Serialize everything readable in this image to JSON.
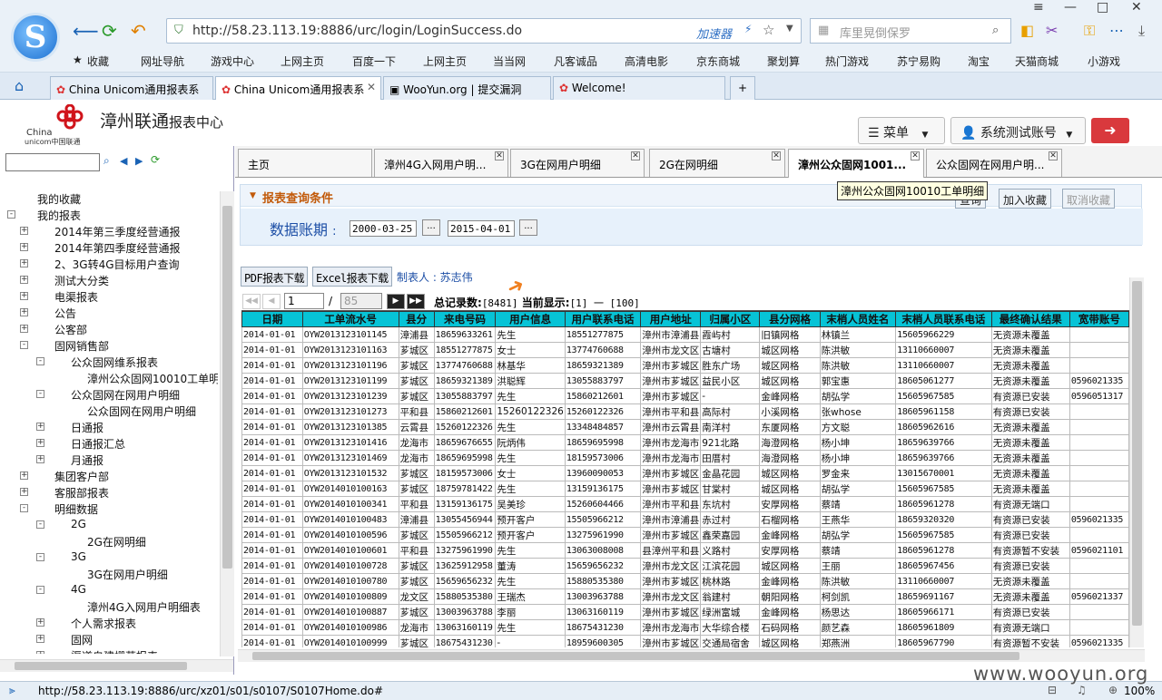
{
  "browser": {
    "url": "http://58.23.113.19:8886/urc/login/LoginSuccess.do",
    "accelerator": "加速器",
    "search_placeholder": "库里晃倒保罗",
    "favorites": [
      "收藏",
      "网址导航",
      "游戏中心",
      "上网主页",
      "百度一下",
      "上网主页",
      "当当网",
      "凡客诚品",
      "高清电影",
      "京东商城",
      "聚划算",
      "热门游戏",
      "苏宁易购",
      "淘宝",
      "天猫商城",
      "小游戏"
    ],
    "tabs": [
      {
        "label": "China Unicom通用报表系",
        "active": false
      },
      {
        "label": "China Unicom通用报表系",
        "active": true
      },
      {
        "label": "WooYun.org | 提交漏洞",
        "active": false
      },
      {
        "label": "Welcome!",
        "active": false
      }
    ],
    "status_url": "http://58.23.113.19:8886/urc/xz01/s01/s0107/S0107Home.do#",
    "zoom": "100%"
  },
  "app": {
    "logo_en_line1": "China",
    "logo_en_line2": "unicom中国联通",
    "title_main": "漳州联通",
    "title_sub": "报表中心",
    "menu_label": "菜单",
    "account_label": "系统测试账号"
  },
  "sidebar": {
    "tree": [
      {
        "label": "我的收藏",
        "level": 0,
        "exp": ""
      },
      {
        "label": "我的报表",
        "level": 0,
        "exp": "-"
      },
      {
        "label": "2014年第三季度经营通报",
        "level": 1,
        "exp": "+"
      },
      {
        "label": "2014年第四季度经营通报",
        "level": 1,
        "exp": "+"
      },
      {
        "label": "2、3G转4G目标用户查询",
        "level": 1,
        "exp": "+"
      },
      {
        "label": "测试大分类",
        "level": 1,
        "exp": "+"
      },
      {
        "label": "电渠报表",
        "level": 1,
        "exp": "+"
      },
      {
        "label": "公告",
        "level": 1,
        "exp": "+"
      },
      {
        "label": "公客部",
        "level": 1,
        "exp": "+"
      },
      {
        "label": "固网销售部",
        "level": 1,
        "exp": "-"
      },
      {
        "label": "公众固网维系报表",
        "level": 2,
        "exp": "-"
      },
      {
        "label": "漳州公众固网10010工单明细",
        "level": 3,
        "exp": ""
      },
      {
        "label": "公众固网在网用户明细",
        "level": 2,
        "exp": "-"
      },
      {
        "label": "公众固网在网用户明细",
        "level": 3,
        "exp": ""
      },
      {
        "label": "日通报",
        "level": 2,
        "exp": "+"
      },
      {
        "label": "日通报汇总",
        "level": 2,
        "exp": "+"
      },
      {
        "label": "月通报",
        "level": 2,
        "exp": "+"
      },
      {
        "label": "集团客户部",
        "level": 1,
        "exp": "+"
      },
      {
        "label": "客服部报表",
        "level": 1,
        "exp": "+"
      },
      {
        "label": "明细数据",
        "level": 1,
        "exp": "-"
      },
      {
        "label": "2G",
        "level": 2,
        "exp": "-"
      },
      {
        "label": "2G在网明细",
        "level": 3,
        "exp": ""
      },
      {
        "label": "3G",
        "level": 2,
        "exp": "-"
      },
      {
        "label": "3G在网用户明细",
        "level": 3,
        "exp": ""
      },
      {
        "label": "4G",
        "level": 2,
        "exp": "-"
      },
      {
        "label": "漳州4G入网用户明细表",
        "level": 3,
        "exp": ""
      },
      {
        "label": "个人需求报表",
        "level": 2,
        "exp": "+"
      },
      {
        "label": "固网",
        "level": 2,
        "exp": "+"
      },
      {
        "label": "渠道自建栅草报表",
        "level": 2,
        "exp": "+"
      }
    ]
  },
  "main": {
    "tabs": [
      {
        "label": "主页",
        "active": false,
        "closable": false
      },
      {
        "label": "漳州4G入网用户明...",
        "active": false,
        "closable": true
      },
      {
        "label": "3G在网用户明细",
        "active": false,
        "closable": true
      },
      {
        "label": "2G在网明细",
        "active": false,
        "closable": true
      },
      {
        "label": "漳州公众固网1001...",
        "active": true,
        "closable": true
      },
      {
        "label": "公众固网在网用户明...",
        "active": false,
        "closable": true
      }
    ],
    "tooltip": "漳州公众固网10010工单明细",
    "query_title": "报表查询条件",
    "query_btn": "查询",
    "fav_add_btn": "加入收藏",
    "fav_cancel_btn": "取消收藏",
    "period_label": "数据账期",
    "period_sep": ":",
    "date_from": "2000-03-25",
    "date_to": "2015-04-01",
    "pdf_btn": "PDF报表下载",
    "excel_btn": "Excel报表下载",
    "maker": "制表人 : 苏志伟",
    "pager": {
      "page": "1",
      "sep": "/",
      "total_pages": "85",
      "total_label": "总记录数:",
      "total": "[8481]",
      "current_label": "当前显示:",
      "current": "[1] 一 [100]"
    },
    "columns": [
      "日期",
      "工单流水号",
      "县分",
      "来电号码",
      "用户信息",
      "用户联系电话",
      "用户地址",
      "归属小区",
      "县分网格",
      "末梢人员姓名",
      "末梢人员联系电话",
      "最终确认结果",
      "宽带账号"
    ],
    "rows": [
      [
        "2014-01-01",
        "OYW2013123101145",
        "漳浦县",
        "18659633261",
        "先生",
        "18551277875",
        "漳州市漳浦县",
        "霞屿村",
        "旧镇网格",
        "林镇兰",
        "15605966229",
        "无资源未覆盖",
        ""
      ],
      [
        "2014-01-01",
        "OYW2013123101163",
        "芗城区",
        "18551277875",
        "女士",
        "13774760688",
        "漳州市龙文区",
        "古塘村",
        "城区网格",
        "陈洪敏",
        "13110660007",
        "无资源未覆盖",
        ""
      ],
      [
        "2014-01-01",
        "OYW2013123101196",
        "芗城区",
        "13774760688",
        "林基华",
        "18659321389",
        "漳州市芗城区",
        "胜东广场",
        "城区网格",
        "陈洪敏",
        "13110660007",
        "无资源未覆盖",
        ""
      ],
      [
        "2014-01-01",
        "OYW2013123101199",
        "芗城区",
        "18659321389",
        "洪聪辉",
        "13055883797",
        "漳州市芗城区",
        "益民小区",
        "城区网格",
        "郭宝惠",
        "18605061277",
        "无资源未覆盖",
        "0596021335"
      ],
      [
        "2014-01-01",
        "OYW2013123101239",
        "芗城区",
        "13055883797",
        "先生",
        "15860212601",
        "漳州市芗城区",
        "-",
        "金峰网格",
        "胡弘学",
        "15605967585",
        "有资源已安装",
        "0596051317"
      ],
      [
        "2014-01-01",
        "OYW2013123101273",
        "平和县",
        "15860212601",
        "15260122326",
        "15260122326",
        "漳州市平和县",
        "高际村",
        "小溪网格",
        "张whose",
        "18605961158",
        "有资源已安装",
        ""
      ],
      [
        "2014-01-01",
        "OYW2013123101385",
        "云霄县",
        "15260122326",
        "先生",
        "13348484857",
        "漳州市云霄县",
        "南洋村",
        "东厦网格",
        "方文聪",
        "18605962616",
        "无资源未覆盖",
        ""
      ],
      [
        "2014-01-01",
        "OYW2013123101416",
        "龙海市",
        "18659676655",
        "阮炳伟",
        "18659695998",
        "漳州市龙海市",
        "921北路",
        "海澄网格",
        "杨小坤",
        "18659639766",
        "无资源未覆盖",
        ""
      ],
      [
        "2014-01-01",
        "OYW2013123101469",
        "龙海市",
        "18659695998",
        "先生",
        "18159573006",
        "漳州市龙海市",
        "田厝村",
        "海澄网格",
        "杨小坤",
        "18659639766",
        "无资源未覆盖",
        ""
      ],
      [
        "2014-01-01",
        "OYW2013123101532",
        "芗城区",
        "18159573006",
        "女士",
        "13960090053",
        "漳州市芗城区",
        "金晶花园",
        "城区网格",
        "罗金来",
        "13015670001",
        "无资源未覆盖",
        ""
      ],
      [
        "2014-01-01",
        "OYW2014010100163",
        "芗城区",
        "18759781422",
        "先生",
        "13159136175",
        "漳州市芗城区",
        "甘棠村",
        "城区网格",
        "胡弘学",
        "15605967585",
        "无资源未覆盖",
        ""
      ],
      [
        "2014-01-01",
        "OYW2014010100341",
        "平和县",
        "13159136175",
        "吴美珍",
        "15260604466",
        "漳州市平和县",
        "东坑村",
        "安厚网格",
        "蔡靖",
        "18605961278",
        "有资源无端口",
        ""
      ],
      [
        "2014-01-01",
        "OYW2014010100483",
        "漳浦县",
        "13055456944",
        "预开客户",
        "15505966212",
        "漳州市漳浦县",
        "赤过村",
        "石榴网格",
        "王燕华",
        "18659320320",
        "有资源已安装",
        "0596021335"
      ],
      [
        "2014-01-01",
        "OYW2014010100596",
        "芗城区",
        "15505966212",
        "预开客户",
        "13275961990",
        "漳州市芗城区",
        "鑫荣嘉园",
        "金峰网格",
        "胡弘学",
        "15605967585",
        "有资源已安装",
        ""
      ],
      [
        "2014-01-01",
        "OYW2014010100601",
        "平和县",
        "13275961990",
        "先生",
        "13063008008",
        "县漳州平和县",
        "义路村",
        "安厚网格",
        "蔡靖",
        "18605961278",
        "有资源暂不安装",
        "0596021101"
      ],
      [
        "2014-01-01",
        "OYW2014010100728",
        "芗城区",
        "13625912958",
        "董涛",
        "15659656232",
        "漳州市龙文区",
        "江滨花园",
        "城区网格",
        "王丽",
        "18605967456",
        "有资源已安装",
        ""
      ],
      [
        "2014-01-01",
        "OYW2014010100780",
        "芗城区",
        "15659656232",
        "先生",
        "15880535380",
        "漳州市芗城区",
        "桃林路",
        "金峰网格",
        "陈洪敏",
        "13110660007",
        "无资源未覆盖",
        ""
      ],
      [
        "2014-01-01",
        "OYW2014010100809",
        "龙文区",
        "15880535380",
        "王瑞杰",
        "13003963788",
        "漳州市龙文区",
        "翁建村",
        "朝阳网格",
        "柯剑凯",
        "18659691167",
        "无资源未覆盖",
        "0596021337"
      ],
      [
        "2014-01-01",
        "OYW2014010100887",
        "芗城区",
        "13003963788",
        "李丽",
        "13063160119",
        "漳州市芗城区",
        "绿洲富城",
        "金峰网格",
        "杨思达",
        "18605966171",
        "有资源已安装",
        ""
      ],
      [
        "2014-01-01",
        "OYW2014010100986",
        "龙海市",
        "13063160119",
        "先生",
        "18675431230",
        "漳州市龙海市",
        "大华综合楼",
        "石码网格",
        "颜艺森",
        "18605961809",
        "有资源无端口",
        ""
      ],
      [
        "2014-01-01",
        "OYW2014010100999",
        "芗城区",
        "18675431230",
        "-",
        "18959600305",
        "漳州市芗城区",
        "交通局宿舍",
        "城区网格",
        "郑燕洲",
        "18605967790",
        "有资源暂不安装",
        "0596021335"
      ]
    ]
  },
  "watermark": "www.wooyun.org"
}
